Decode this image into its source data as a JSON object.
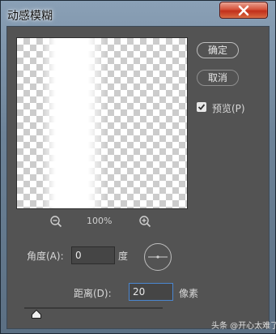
{
  "window": {
    "title": "动感模糊"
  },
  "preview": {
    "zoom_label": "100%"
  },
  "buttons": {
    "ok_label": "确定",
    "cancel_label": "取消"
  },
  "preview_toggle": {
    "label": "预览(P)",
    "checked": true
  },
  "angle": {
    "label": "角度(A):",
    "value": "0",
    "unit": "度"
  },
  "distance": {
    "label": "距离(D):",
    "value": "20",
    "unit": "像素",
    "slider_level": 20
  },
  "watermark": {
    "text": "头条 @开心太难了"
  },
  "colors": {
    "dialog_bg": "#535353",
    "close_button": "#c12f1b",
    "focus_border": "#4a86d0"
  },
  "icons": {
    "close": "close-icon",
    "zoom_out": "zoom-out-icon",
    "zoom_in": "zoom-in-icon",
    "check": "check-icon"
  }
}
